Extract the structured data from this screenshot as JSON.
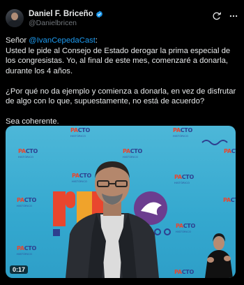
{
  "author": {
    "display_name": "Daniel F. Briceño",
    "handle": "@Danielbricen"
  },
  "tweet": {
    "greeting": "Señor ",
    "mention": "@IvanCepedaCast",
    "after_mention": ":",
    "line1_rest": "Usted le pide al Consejo de Estado derogar la prima especial de los congresistas. Yo, al final de este mes, comenzaré a donarla, durante los 4 años.",
    "para2": "¿Por qué no da ejemplo y comienza a donarla, en vez de disfrutar de algo con lo que, supuestamente, no está de acuerdo?",
    "para3": "Sea coherente."
  },
  "video": {
    "duration": "0:17"
  },
  "icons": {
    "verified": "verified-badge-icon",
    "grok": "grok-icon",
    "more": "more-icon",
    "accent": "#1d9bf0"
  }
}
